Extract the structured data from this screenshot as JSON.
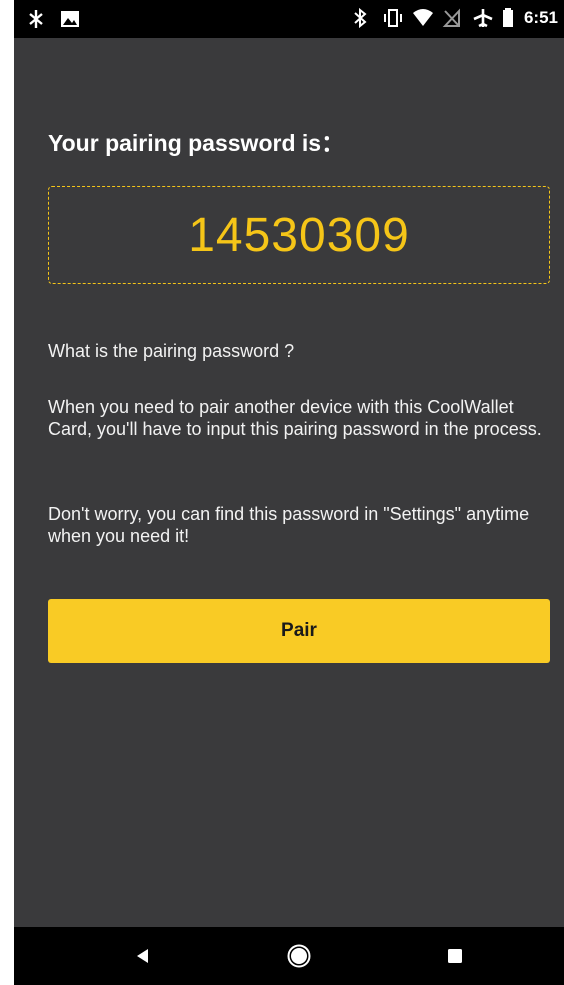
{
  "status_bar": {
    "time": "6:51",
    "icons_left": [
      "data-saver-icon",
      "image-icon"
    ],
    "icons_right": [
      "bluetooth-icon",
      "vibrate-icon",
      "wifi-icon",
      "no-sim-icon",
      "airplane-icon",
      "battery-icon"
    ]
  },
  "main": {
    "heading": "Your pairing password is：",
    "password": "14530309",
    "question": "What is the pairing password ?",
    "paragraph_1": "When you need to pair another device with this CoolWallet Card, you'll have to input this pairing password in the process.",
    "paragraph_2": "Don't worry, you can find this password in \"Settings\" anytime when you need it!",
    "pair_button_label": "Pair"
  },
  "nav_bar": {
    "icons": [
      "back-icon",
      "home-icon",
      "recents-icon"
    ]
  },
  "colors": {
    "accent": "#f9cb25",
    "password_text": "#f5c518",
    "background": "#3a3a3c",
    "bars": "#000000"
  }
}
